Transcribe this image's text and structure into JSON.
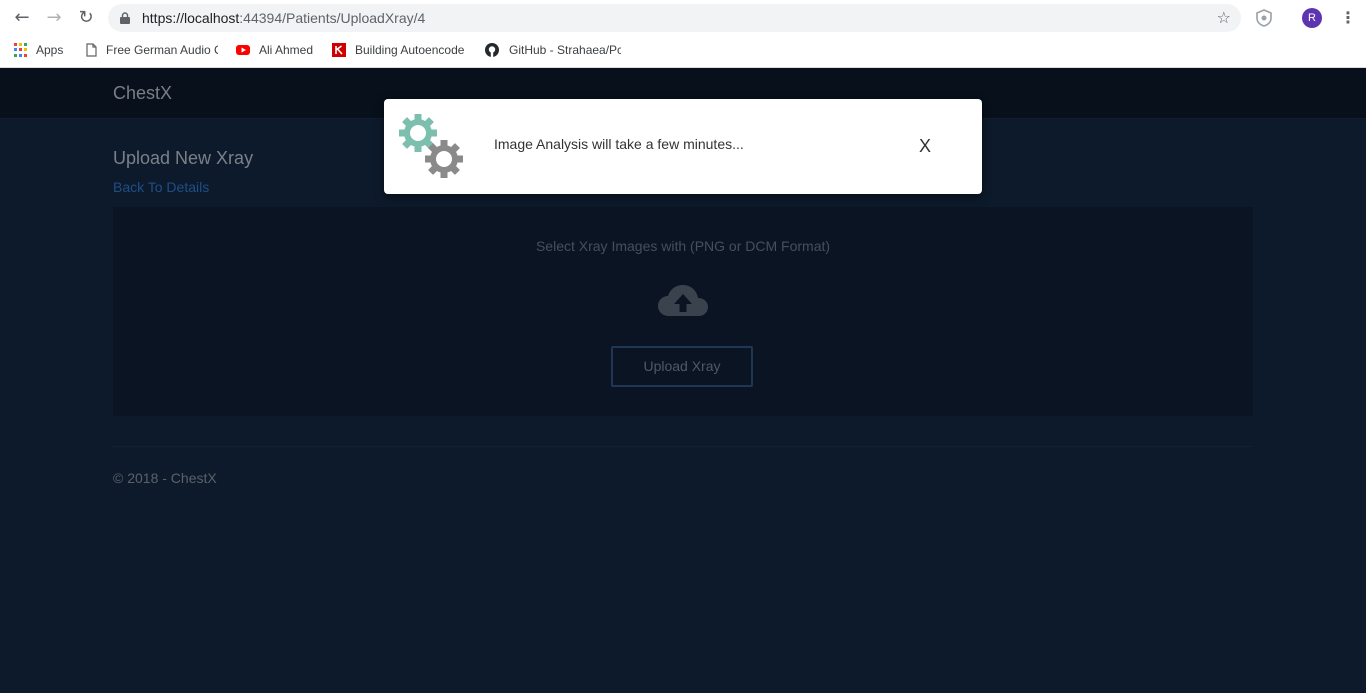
{
  "browser": {
    "url_host": "https://localhost",
    "url_rest": ":44394/Patients/UploadXray/4",
    "avatar_letter": "R",
    "bookmarks": [
      {
        "label": "Apps",
        "icon": "apps-grid-icon"
      },
      {
        "label": "Free German Audio C",
        "icon": "page-icon"
      },
      {
        "label": "Ali Ahmed",
        "icon": "youtube-icon"
      },
      {
        "label": "Building Autoencode",
        "icon": "k-icon"
      },
      {
        "label": "GitHub - Strahaea/Pc",
        "icon": "github-icon"
      }
    ]
  },
  "navbar": {
    "brand": "ChestX"
  },
  "main": {
    "title": "Upload New Xray",
    "back_link": "Back To Details",
    "dropzone_text": "Select Xray Images with (PNG or DCM Format)",
    "upload_button": "Upload Xray"
  },
  "footer": {
    "text": "© 2018 - ChestX"
  },
  "modal": {
    "message": "Image Analysis will take a few minutes...",
    "close_label": "X",
    "icon": "gears-icon"
  },
  "colors": {
    "overlay_bg": "#0d1a2b",
    "link": "#1e4f86",
    "gear_teal": "#7dbfae",
    "gear_gray": "#8a8a8a",
    "avatar": "#5e35b1"
  }
}
